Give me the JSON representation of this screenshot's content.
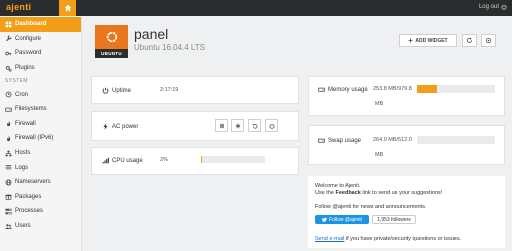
{
  "topbar": {
    "brand": "ajenti",
    "logout_label": "Log out",
    "home_icon": "home-icon",
    "accent_color": "#f29e18"
  },
  "sidebar": {
    "items_top": [
      {
        "label": "Dashboard",
        "icon": "dashboard-icon",
        "active": true
      },
      {
        "label": "Configure",
        "icon": "wrench-icon"
      },
      {
        "label": "Password",
        "icon": "key-icon"
      },
      {
        "label": "Plugins",
        "icon": "cogs-icon"
      }
    ],
    "section_label": "SYSTEM",
    "items_system": [
      {
        "label": "Cron",
        "icon": "clock-icon"
      },
      {
        "label": "Filesystems",
        "icon": "hdd-icon"
      },
      {
        "label": "Firewall",
        "icon": "fire-icon"
      },
      {
        "label": "Firewall (IPv6)",
        "icon": "fire-icon"
      },
      {
        "label": "Hosts",
        "icon": "sitemap-icon"
      },
      {
        "label": "Logs",
        "icon": "list-icon"
      },
      {
        "label": "Nameservers",
        "icon": "globe-icon"
      },
      {
        "label": "Packages",
        "icon": "gift-icon"
      },
      {
        "label": "Processes",
        "icon": "tasks-icon"
      },
      {
        "label": "Users",
        "icon": "users-icon"
      }
    ]
  },
  "header": {
    "title": "panel",
    "subtitle": "Ubuntu 16.04.4 LTS",
    "logo_label": "UBUNTU",
    "add_widget_label": "ADD WIDGET"
  },
  "widgets": {
    "uptime": {
      "label": "Uptime",
      "value": "2:17:19"
    },
    "ac_power": {
      "label": "AC power"
    },
    "cpu": {
      "label": "CPU usage",
      "value": "2%",
      "percent": 2
    },
    "memory": {
      "label": "Memory usage",
      "value": "253.8 MB/979.8",
      "unit": "MB",
      "percent": 26
    },
    "swap": {
      "label": "Swap usage",
      "value": "264.0 MB/512.0",
      "unit": "MB",
      "percent": 0
    }
  },
  "welcome": {
    "line1": "Welcome to Ajenti.",
    "line2_pre": "Use the ",
    "line2_bold": "Feedback",
    "line2_post": " link to send us your suggestions!",
    "line3": "Follow @ajenti for news and announcements.",
    "follow_label": "Follow @ajenti",
    "followers_label": "1,953 followers",
    "email_link": "Send e-mail",
    "email_post": " if you have private/security questions or issues."
  }
}
